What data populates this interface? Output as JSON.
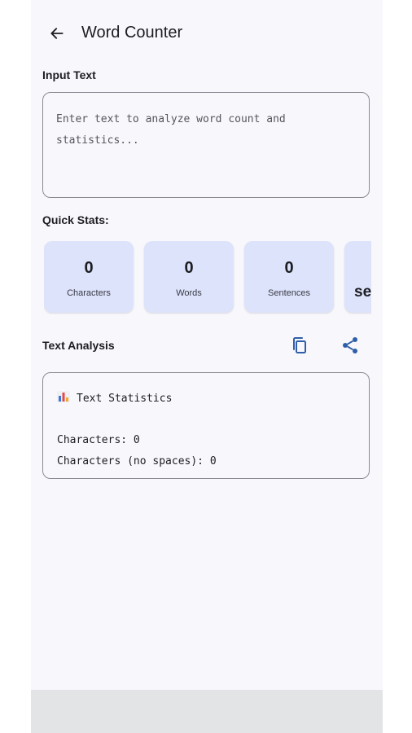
{
  "header": {
    "title": "Word Counter",
    "back_icon": "arrow-left-icon"
  },
  "input": {
    "section_label": "Input Text",
    "value": "",
    "placeholder": "Enter text to analyze word count and statistics..."
  },
  "quick_stats": {
    "section_label": "Quick Stats:",
    "card_color": "#dce3fb",
    "cards": [
      {
        "value": "0",
        "label": "Characters"
      },
      {
        "value": "0",
        "label": "Words"
      },
      {
        "value": "0",
        "label": "Sentences"
      },
      {
        "value": "se",
        "label": ""
      }
    ]
  },
  "analysis": {
    "section_label": "Text Analysis",
    "copy_icon": "copy-icon",
    "share_icon": "share-icon",
    "panel_title": "Text Statistics",
    "panel_icon": "bar-chart-icon",
    "lines": [
      "Characters: 0",
      "Characters (no spaces): 0"
    ]
  }
}
